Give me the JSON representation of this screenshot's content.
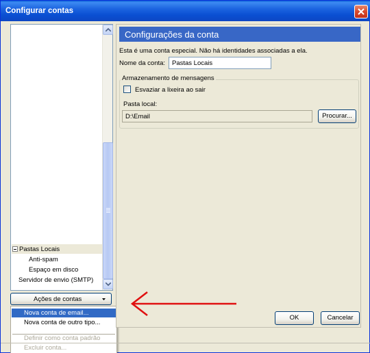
{
  "window": {
    "title": "Configurar contas"
  },
  "tree": {
    "items": [
      {
        "label": "Pastas Locais",
        "expanded": true
      },
      {
        "label": "Anti-spam"
      },
      {
        "label": "Espaço em disco"
      },
      {
        "label": "Servidor de envio (SMTP)"
      }
    ]
  },
  "account_actions": {
    "label": "Ações de contas",
    "menu": [
      {
        "label": "Nova conta de email...",
        "highlighted": true
      },
      {
        "label": "Nova conta de outro tipo..."
      },
      {
        "label": "Definir como conta padrão",
        "disabled": true
      },
      {
        "label": "Excluir conta...",
        "disabled": true
      }
    ]
  },
  "settings": {
    "header": "Configurações da conta",
    "description": "Esta é uma conta especial. Não há identidades associadas a ela.",
    "account_name_label": "Nome da conta:",
    "account_name_value": "Pastas Locais",
    "storage_group_title": "Armazenamento de mensagens",
    "empty_trash_label": "Esvaziar a lixeira ao sair",
    "empty_trash_checked": false,
    "local_folder_label": "Pasta local:",
    "local_folder_value": "D:\\Email",
    "browse_label": "Procurar..."
  },
  "buttons": {
    "ok": "OK",
    "cancel": "Cancelar"
  },
  "colors": {
    "title_bar": "#0a4fd2",
    "header_bar": "#3867c6",
    "menu_highlight": "#316ac5",
    "annotation_arrow": "#e01010"
  }
}
